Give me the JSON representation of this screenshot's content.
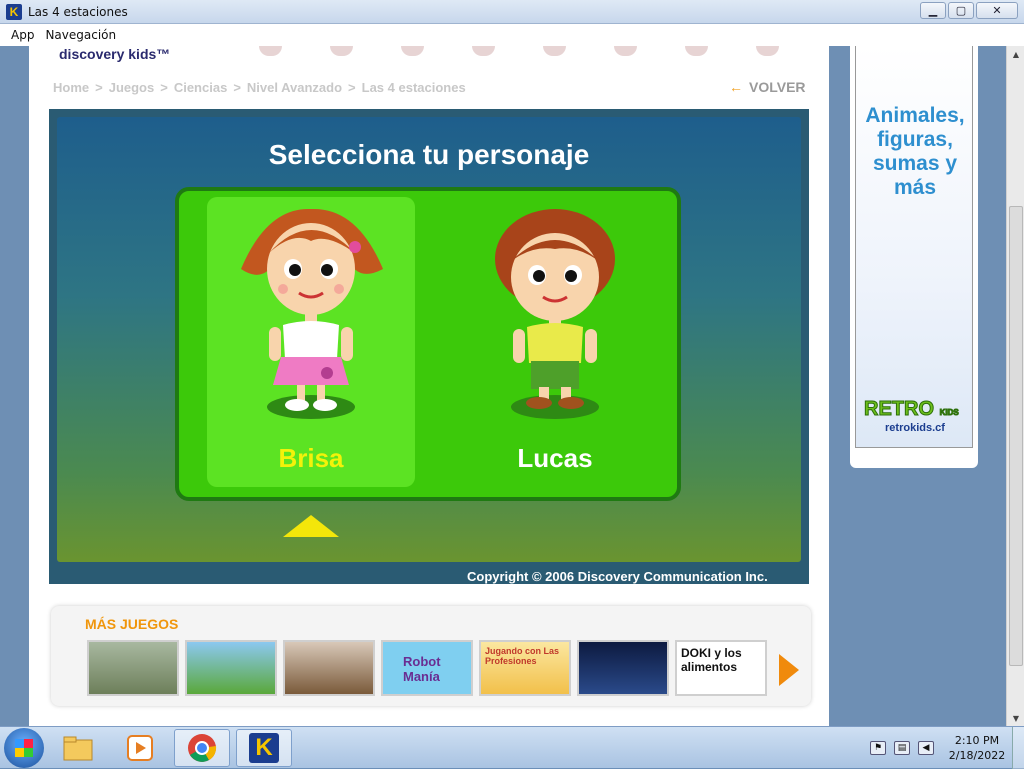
{
  "window": {
    "title": "Las 4 estaciones",
    "minimize": "▁",
    "maximize": "▢",
    "close": "✕"
  },
  "menu": [
    "App",
    "Navegación"
  ],
  "site": {
    "logo": "discovery kids™"
  },
  "breadcrumb": [
    "Home",
    ">",
    "Juegos",
    ">",
    "Ciencias",
    ">",
    "Nivel Avanzado",
    ">",
    "Las 4 estaciones"
  ],
  "volver": {
    "arrow": "←",
    "label": "VOLVER"
  },
  "game": {
    "title": "Selecciona tu personaje",
    "characters": [
      {
        "name": "Brisa",
        "selected": true
      },
      {
        "name": "Lucas",
        "selected": false
      }
    ],
    "copyright": "Copyright © 2006 Discovery Communication Inc."
  },
  "more_games": {
    "title": "MÁS JUEGOS",
    "thumbs": [
      {
        "label": ""
      },
      {
        "label": ""
      },
      {
        "label": ""
      },
      {
        "label": "Robot Manía"
      },
      {
        "label": "Jugando con Las Profesiones"
      },
      {
        "label": ""
      },
      {
        "label": "DOKI y los alimentos"
      }
    ]
  },
  "ad": {
    "text": "Animales, figuras, sumas y más",
    "brand": "RETRO",
    "brand_sub": "KIDS",
    "url": "retrokids.cf"
  },
  "taskbar": {
    "time": "2:10 PM",
    "date": "2/18/2022"
  },
  "colors": {
    "game_green": "#3cc90a",
    "selected_name": "#f3f20a",
    "accent_orange": "#f0960c"
  }
}
